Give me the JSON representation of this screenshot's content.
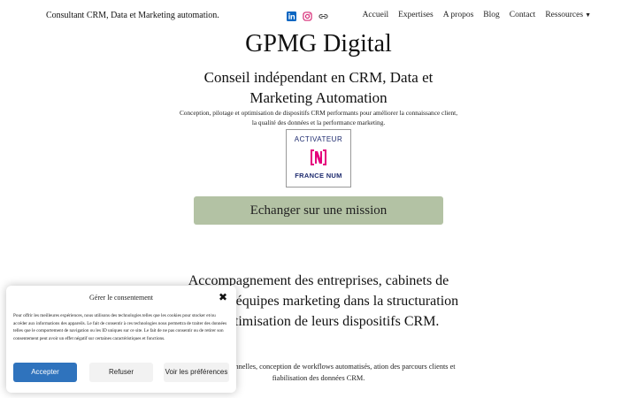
{
  "header": {
    "site_title": "Consultant CRM, Data et Marketing automation.",
    "nav": {
      "accueil": "Accueil",
      "expertises": "Expertises",
      "apropos": "A propos",
      "blog": "Blog",
      "contact": "Contact",
      "ressources": "Ressources"
    }
  },
  "hero": {
    "title": "GPMG Digital",
    "subtitle": "Conseil indépendant en CRM, Data et Marketing Automation",
    "description": "Conception, pilotage et optimisation de dispositifs CRM performants pour améliorer la connaissance client, la qualité des données et la performance marketing.",
    "badge": {
      "top": "ACTIVATEUR",
      "bottom": "FRANCE NUM"
    },
    "cta": "Echanger sur une mission"
  },
  "section": {
    "title": "Accompagnement des entreprises, cabinets de conseil et équipes marketing dans la structuration et l’optimisation de leurs dispositifs CRM.",
    "description": "campagnes relationnelles, conception de workflows automatisés, ation des parcours clients et fiabilisation des données CRM."
  },
  "cookie": {
    "title": "Gérer le consentement",
    "text": "Pour offrir les meilleures expériences, nous utilisons des technologies telles que les cookies pour stocker et/ou accéder aux informations des appareils. Le fait de consentir à ces technologies nous permettra de traiter des données telles que le comportement de navigation ou les ID uniques sur ce site. Le fait de ne pas consentir ou de retirer son consentement peut avoir un effet négatif sur certaines caractéristiques et fonctions.",
    "accept": "Accepter",
    "refuse": "Refuser",
    "preferences": "Voir les préférences"
  },
  "colors": {
    "cta_bg": "#b3c2a4",
    "accept_bg": "#2f73bd",
    "linkedin": "#0a66c2",
    "instagram": "#d62976",
    "badge_accent": "#e5007d"
  },
  "icons": [
    "linkedin-icon",
    "instagram-icon",
    "link-icon",
    "chevron-down-icon",
    "close-icon"
  ]
}
